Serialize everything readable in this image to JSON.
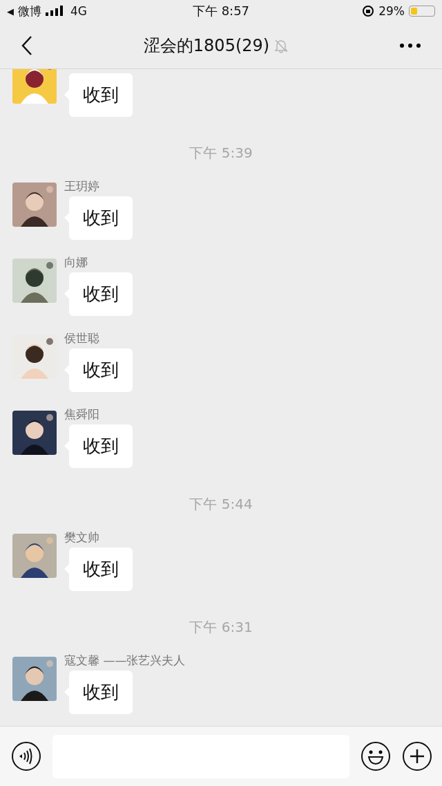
{
  "status_bar": {
    "back_arrow": "◀",
    "back_app": "微博",
    "network": "4G",
    "time": "下午 8:57",
    "battery_text": "29%"
  },
  "header": {
    "title": "涩会的1805(29)",
    "muted": true
  },
  "messages": [
    {
      "kind": "message",
      "text": "收到"
    },
    {
      "kind": "time",
      "text": "下午 5:39"
    },
    {
      "kind": "message",
      "sender": "王玥婷",
      "text": "收到"
    },
    {
      "kind": "message",
      "sender": "向娜",
      "text": "收到"
    },
    {
      "kind": "message",
      "sender": "侯世聪",
      "text": "收到"
    },
    {
      "kind": "message",
      "sender": "焦舜阳",
      "text": "收到"
    },
    {
      "kind": "time",
      "text": "下午 5:44"
    },
    {
      "kind": "message",
      "sender": "樊文帅",
      "text": "收到"
    },
    {
      "kind": "time",
      "text": "下午 6:31"
    },
    {
      "kind": "message",
      "sender": "寇文馨 ——张艺兴夫人",
      "text": "收到"
    }
  ]
}
